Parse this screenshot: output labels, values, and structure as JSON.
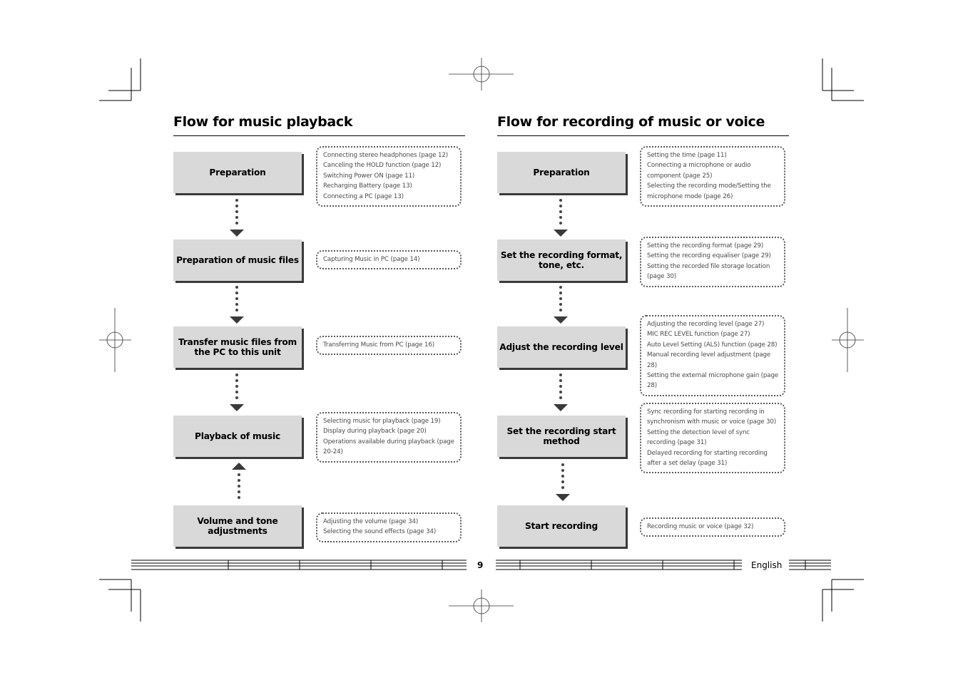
{
  "left_section": {
    "title": "Flow for music playback",
    "steps": [
      {
        "label": "Preparation",
        "notes": [
          "Connecting stereo headphones (page 12)",
          "Canceling the HOLD function (page 12)",
          "Switching Power ON (page 11)",
          "Recharging Battery (page 13)",
          "Connecting a PC (page 13)"
        ]
      },
      {
        "label": "Preparation of music files",
        "notes": [
          "Capturing Music in PC (page 14)"
        ]
      },
      {
        "label": "Transfer music files from the PC to this unit",
        "notes": [
          "Transferring Music from PC (page 16)"
        ]
      },
      {
        "label": "Playback of music",
        "notes": [
          "Selecting music for playback (page 19)",
          "Display during playback (page 20)",
          "Operations available during playback (page 20-24)"
        ]
      },
      {
        "label": "Volume and tone adjustments",
        "notes": [
          "Adjusting the volume (page 34)",
          "Selecting the sound effects (page 34)"
        ]
      }
    ]
  },
  "right_section": {
    "title": "Flow for recording of music or voice",
    "steps": [
      {
        "label": "Preparation",
        "notes": [
          "Setting the time (page 11)",
          "Connecting a microphone or audio component (page 25)",
          "Selecting the recording mode/Setting the microphone mode (page 26)"
        ]
      },
      {
        "label": "Set the recording format, tone, etc.",
        "notes": [
          "Setting the recording format (page 29)",
          "Setting the recording equaliser (page 29)",
          "Setting the recorded file storage location (page 30)"
        ]
      },
      {
        "label": "Adjust the recording level",
        "notes": [
          "Adjusting the recording level (page 27)",
          "MIC REC LEVEL function (page 27)",
          "Auto Level Setting (ALS) function (page 28)",
          "Manual recording level adjustment (page 28)",
          "Setting the external microphone gain (page 28)"
        ]
      },
      {
        "label": "Set the recording start method",
        "notes": [
          "Sync recording for starting recording in synchronism with music or voice (page 30)",
          "Setting the detection level of sync recording (page 31)",
          "Delayed recording for starting recording after a set delay (page 31)"
        ]
      },
      {
        "label": "Start recording",
        "notes": [
          "Recording music or voice (page 32)"
        ]
      }
    ]
  },
  "footer": {
    "page_number": "9",
    "language": "English"
  }
}
